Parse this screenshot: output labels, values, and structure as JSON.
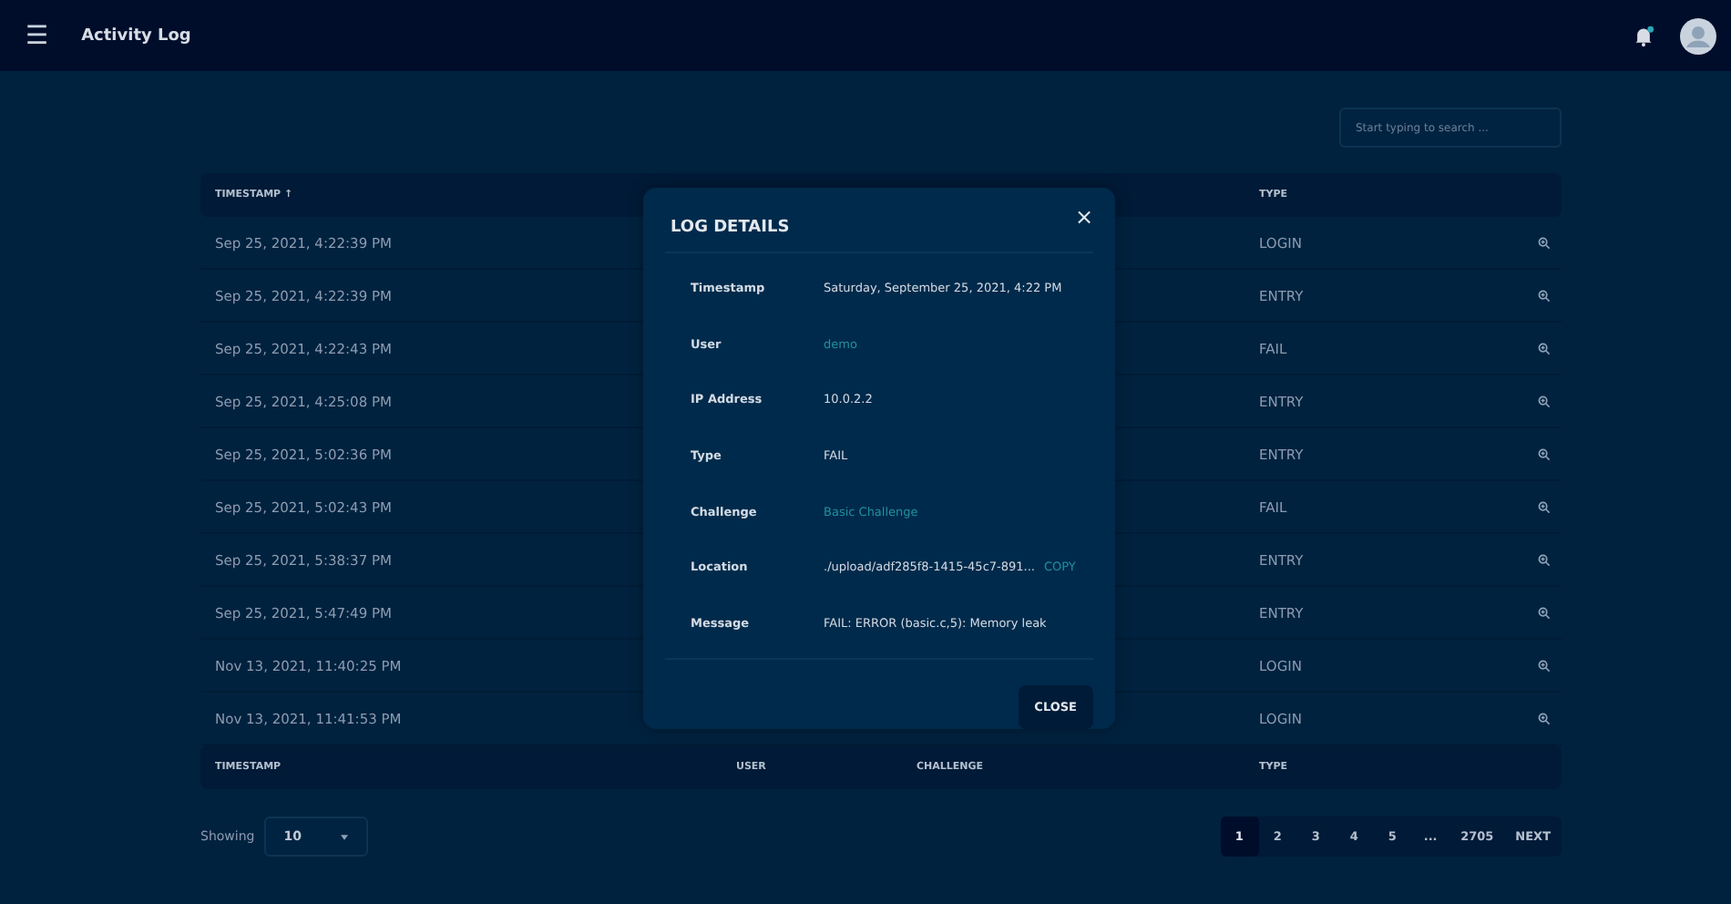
{
  "topbar": {
    "menu_icon": "☰",
    "title": "Activity Log",
    "notification_dot": true
  },
  "search": {
    "placeholder": "Start typing to search ..."
  },
  "table": {
    "header": [
      {
        "label": "TIMESTAMP",
        "sort": "↑"
      },
      {
        "label": "TYPE"
      }
    ],
    "rows": [
      {
        "timestamp": "Sep 25, 2021, 4:22:39 PM",
        "type": "LOGIN"
      },
      {
        "timestamp": "Sep 25, 2021, 4:22:39 PM",
        "type": "ENTRY"
      },
      {
        "timestamp": "Sep 25, 2021, 4:22:43 PM",
        "type": "FAIL"
      },
      {
        "timestamp": "Sep 25, 2021, 4:25:08 PM",
        "type": "ENTRY"
      },
      {
        "timestamp": "Sep 25, 2021, 5:02:36 PM",
        "type": "ENTRY"
      },
      {
        "timestamp": "Sep 25, 2021, 5:02:43 PM",
        "type": "FAIL"
      },
      {
        "timestamp": "Sep 25, 2021, 5:38:37 PM",
        "type": "ENTRY"
      },
      {
        "timestamp": "Sep 25, 2021, 5:47:49 PM",
        "type": "ENTRY"
      },
      {
        "timestamp": "Nov 13, 2021, 11:40:25 PM",
        "type": "LOGIN"
      },
      {
        "timestamp": "Nov 13, 2021, 11:41:53 PM",
        "type": "LOGIN"
      }
    ],
    "footer": [
      "TIMESTAMP",
      "USER",
      "CHALLENGE",
      "TYPE"
    ]
  },
  "paging": {
    "showing_label": "Showing",
    "page_size": "10",
    "pages": [
      {
        "label": "1",
        "selected": true
      },
      {
        "label": "2",
        "selected": false
      },
      {
        "label": "3",
        "selected": false
      },
      {
        "label": "4",
        "selected": false
      },
      {
        "label": "5",
        "selected": false
      },
      {
        "label": "...",
        "selected": false
      },
      {
        "label": "2705",
        "selected": false
      },
      {
        "label": "NEXT",
        "selected": false
      }
    ]
  },
  "modal": {
    "title": "LOG DETAILS",
    "close_icon": "×",
    "fields": [
      {
        "label": "Timestamp",
        "value": "Saturday, September 25, 2021, 4:22 PM",
        "kind": "text"
      },
      {
        "label": "User",
        "value": "demo",
        "kind": "link"
      },
      {
        "label": "IP Address",
        "value": "10.0.2.2",
        "kind": "text"
      },
      {
        "label": "Type",
        "value": "FAIL",
        "kind": "text"
      },
      {
        "label": "Challenge",
        "value": "Basic Challenge",
        "kind": "link"
      },
      {
        "label": "Location",
        "value": "./upload/adf285f8-1415-45c7-891...",
        "action": "COPY",
        "kind": "copy"
      },
      {
        "label": "Message",
        "value": "FAIL: ERROR (basic.c,5): Memory leak",
        "kind": "text"
      }
    ],
    "button": "CLOSE"
  }
}
